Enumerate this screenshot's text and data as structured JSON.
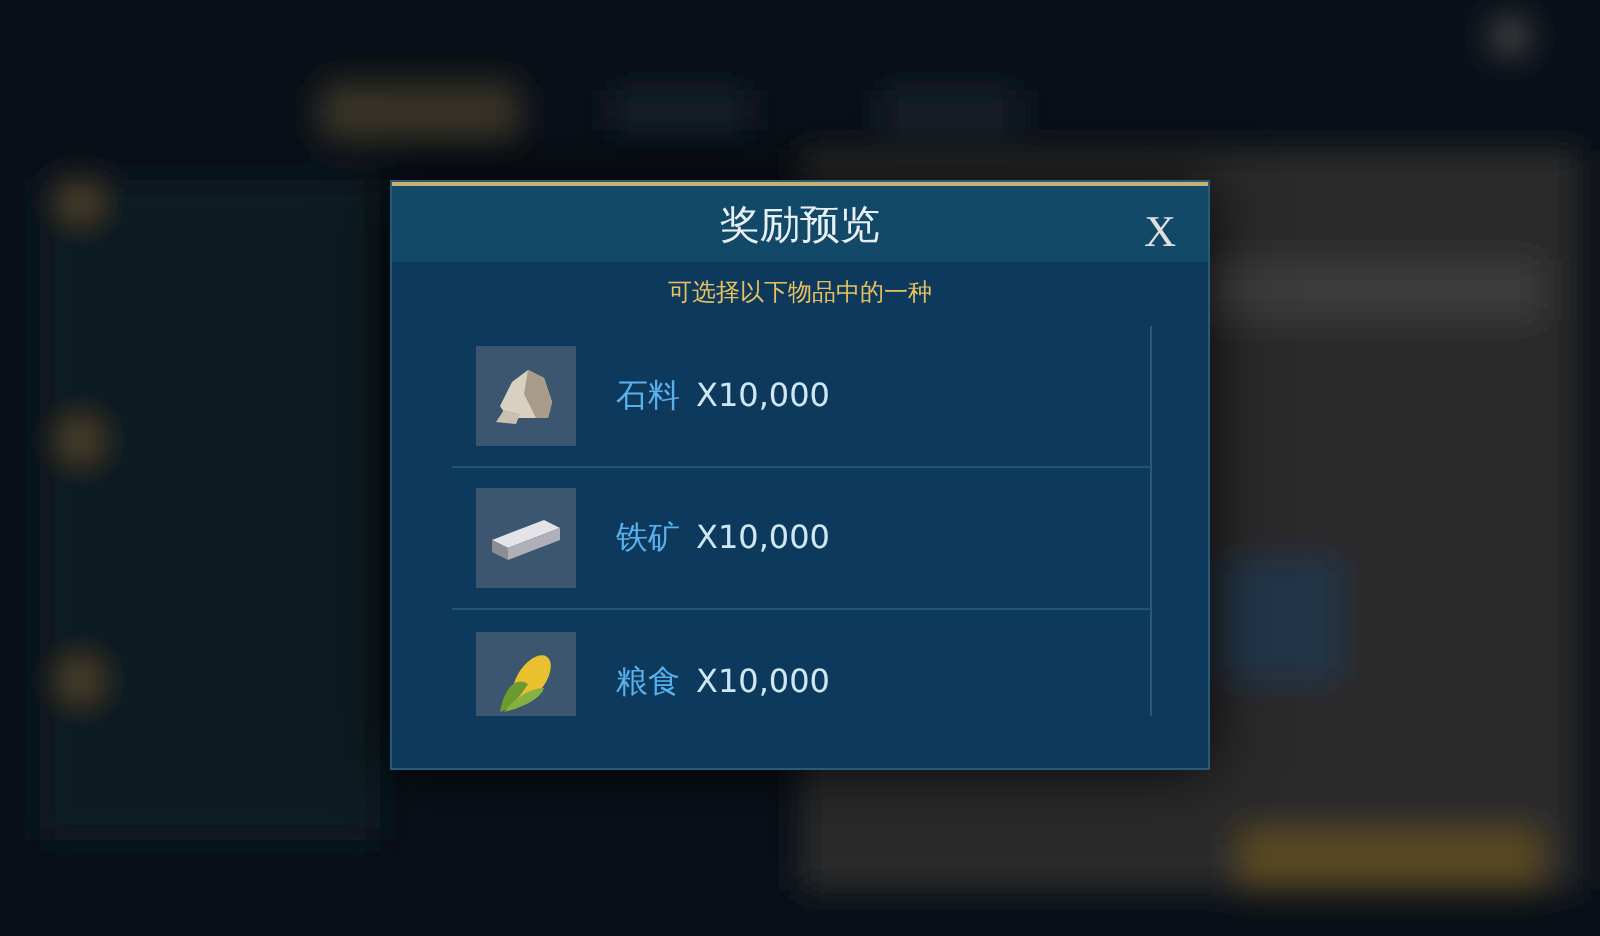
{
  "dialog": {
    "title": "奖励预览",
    "close": "X",
    "subtitle": "可选择以下物品中的一种",
    "items": [
      {
        "kind": "stone",
        "name": "石料",
        "amount": "X10,000"
      },
      {
        "kind": "ingot",
        "name": "铁矿",
        "amount": "X10,000"
      },
      {
        "kind": "corn",
        "name": "粮食",
        "amount": "X10,000"
      }
    ]
  }
}
